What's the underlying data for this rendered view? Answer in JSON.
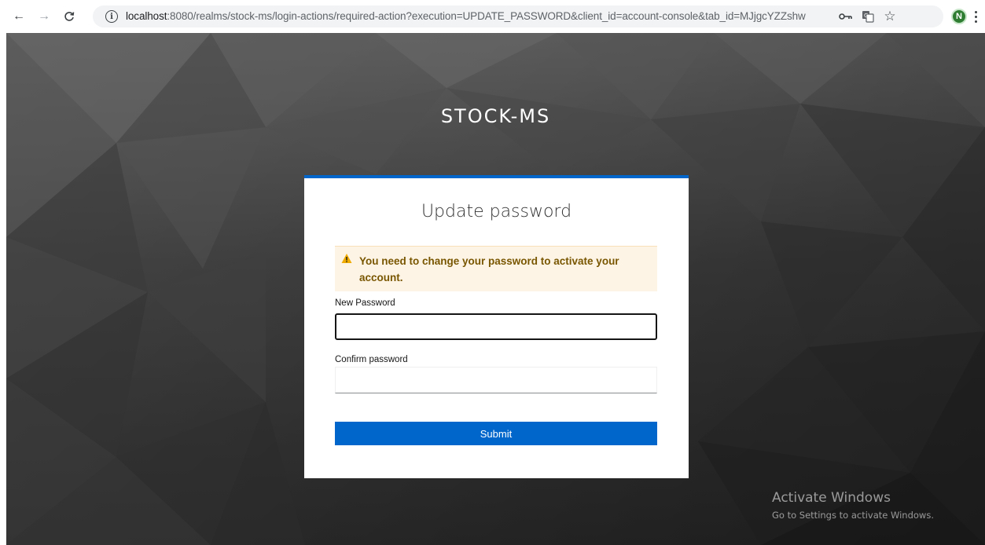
{
  "browser": {
    "url_host": "localhost",
    "url_rest": ":8080/realms/stock-ms/login-actions/required-action?execution=UPDATE_PASSWORD&client_id=account-console&tab_id=MJjgcYZZshw",
    "profile_initial": "N",
    "icons": {
      "back": "arrow-left-icon",
      "forward": "arrow-right-icon",
      "reload": "reload-icon",
      "site_info": "info-icon",
      "passwords": "key-icon",
      "translate": "translate-icon",
      "bookmark": "star-icon",
      "menu": "more-vert-icon"
    }
  },
  "page": {
    "realm_title": "STOCK-MS",
    "card": {
      "title": "Update password",
      "alert": {
        "icon": "warning-triangle-icon",
        "message": "You need to change your password to activate your account."
      },
      "new_password": {
        "label": "New Password",
        "value": ""
      },
      "confirm_password": {
        "label": "Confirm password",
        "value": ""
      },
      "submit_label": "Submit"
    },
    "colors": {
      "accent": "#0066cc",
      "alert_bg": "#fdf4e6",
      "alert_text": "#795600",
      "warning_icon": "#f0ab00"
    }
  },
  "watermark": {
    "title": "Activate Windows",
    "subtitle": "Go to Settings to activate Windows."
  }
}
